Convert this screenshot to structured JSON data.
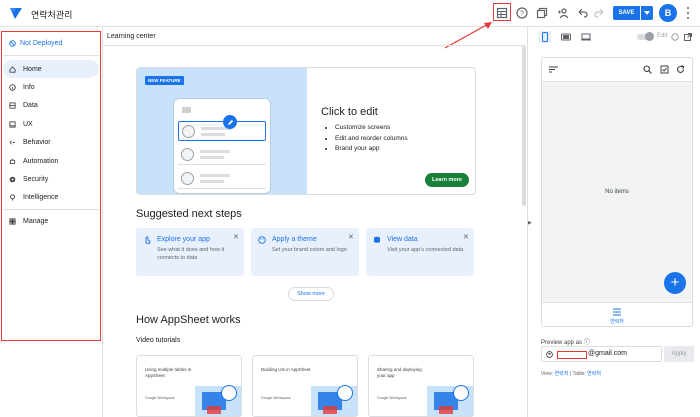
{
  "app": {
    "title": "연락처관리"
  },
  "toolbar": {
    "icons": [
      "spreadsheet-icon",
      "help-icon",
      "copy-icon",
      "share-icon",
      "undo-icon",
      "redo-icon"
    ],
    "save_label": "SAVE",
    "avatar_letter": "B"
  },
  "sidebar": {
    "status": "Not Deployed",
    "items": [
      {
        "label": "Home",
        "icon": "home-icon",
        "active": true
      },
      {
        "label": "Info",
        "icon": "info-icon"
      },
      {
        "label": "Data",
        "icon": "data-icon"
      },
      {
        "label": "UX",
        "icon": "ux-icon"
      },
      {
        "label": "Behavior",
        "icon": "behavior-icon"
      },
      {
        "label": "Automation",
        "icon": "automation-icon"
      },
      {
        "label": "Security",
        "icon": "security-icon"
      },
      {
        "label": "Intelligence",
        "icon": "intelligence-icon"
      }
    ],
    "manage_label": "Manage"
  },
  "main": {
    "header": "Learning center",
    "feature": {
      "badge": "NEW FEATURE",
      "title": "Click to edit",
      "bullets": [
        "Customize screens",
        "Edit and reorder columns",
        "Brand your app"
      ],
      "cta": "Learn more"
    },
    "suggested": {
      "title": "Suggested next steps",
      "cards": [
        {
          "title": "Explore your app",
          "desc": "See what it does and how it connects to data",
          "icon": "touch-icon"
        },
        {
          "title": "Apply a theme",
          "desc": "Set your brand colors and logo",
          "icon": "palette-icon"
        },
        {
          "title": "View data",
          "desc": "Visit your app's connected data",
          "icon": "database-icon"
        }
      ],
      "show_more": "Show more"
    },
    "how": {
      "title": "How AppSheet works",
      "subtitle": "Video tutorials",
      "videos": [
        {
          "title": "Using multiple tables in AppSheet",
          "brand": "Google Workspace"
        },
        {
          "title": "Building UIs in AppSheet",
          "brand": "Google Workspace"
        },
        {
          "title": "Sharing and deploying your app",
          "brand": "Google Workspace"
        }
      ]
    }
  },
  "preview": {
    "edit_label": "Edit",
    "empty_text": "No items",
    "tab_label": "연락처",
    "preview_as_label": "Preview app as",
    "email_domain": "@gmail.com",
    "apply_label": "Apply",
    "view_prefix": "View:",
    "view_value": "연락처",
    "table_prefix": "Table:",
    "table_value": "연락처"
  },
  "colors": {
    "accent": "#1a73e8",
    "annotation": "#e53935",
    "cta_green": "#188038"
  }
}
